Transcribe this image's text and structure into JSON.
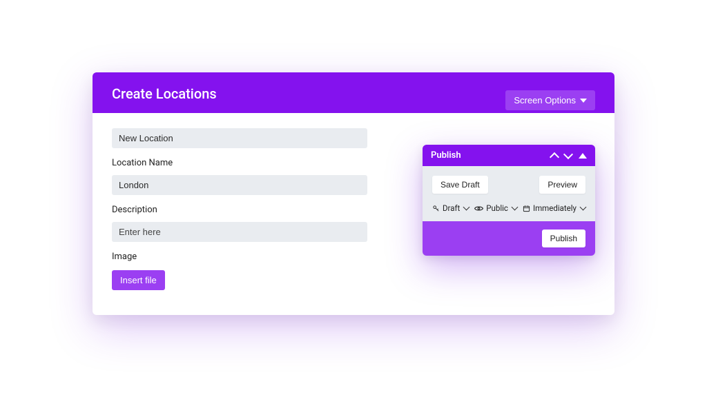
{
  "header": {
    "title": "Create Locations",
    "screen_options": "Screen Options"
  },
  "form": {
    "title_value": "New Location",
    "location_label": "Location Name",
    "location_value": "London",
    "description_label": "Description",
    "description_placeholder": "Enter here",
    "image_label": "Image",
    "insert_file": "Insert file"
  },
  "publish": {
    "title": "Publish",
    "save_draft": "Save Draft",
    "preview": "Preview",
    "status": "Draft",
    "visibility": "Public",
    "schedule": "Immediately",
    "publish_button": "Publish"
  }
}
